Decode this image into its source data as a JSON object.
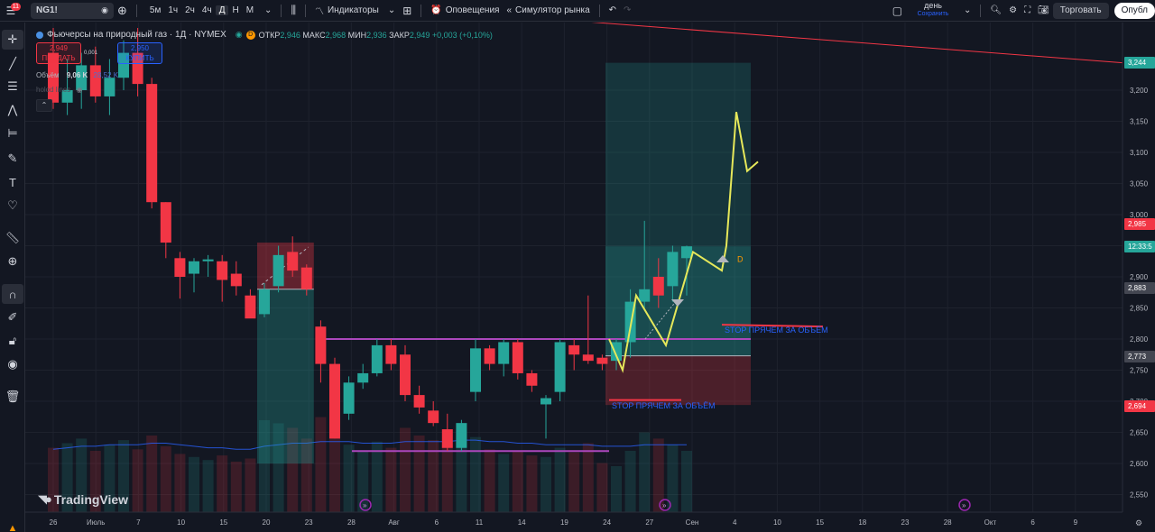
{
  "topbar": {
    "notification_count": "11",
    "symbol": "NG1!",
    "timeframes": [
      "5м",
      "1ч",
      "2ч",
      "4ч",
      "Д",
      "Н",
      "М"
    ],
    "active_timeframe": "Д",
    "indicators_label": "Индикаторы",
    "alerts_label": "Оповещения",
    "replay_label": "Симулятор рынка",
    "layout_name": "день",
    "layout_save": "Сохранить",
    "trade_label": "Торговать",
    "publish_label": "Опубл"
  },
  "legend": {
    "title": "Фьючерсы на природный газ · 1Д · NYMEX",
    "d_badge": "D",
    "open_label": "ОТКР",
    "open": "2,946",
    "high_label": "МАКС",
    "high": "2,968",
    "low_label": "МИН",
    "low": "2,936",
    "close_label": "ЗАКР",
    "close": "2,949",
    "change": "+0,003 (+0,10%)",
    "sell_price": "2,949",
    "sell_label": "ПРОДАТЬ",
    "spread": "0,001",
    "buy_price": "2,950",
    "buy_label": "КУПИТЬ",
    "volume_label": "Объём",
    "volume": "9,06 K",
    "volume_ma": "28,52 K",
    "hold_label": "holod lines"
  },
  "price_axis": {
    "ticks": [
      "3,200",
      "3,150",
      "3,100",
      "3,050",
      "3,000",
      "2,950",
      "2,900",
      "2,850",
      "2,800",
      "2,750",
      "2,700",
      "2,650",
      "2,600",
      "2,550"
    ],
    "badges": [
      {
        "text": "3,244",
        "color": "#26a69a"
      },
      {
        "text": "2,985",
        "color": "#f23645"
      },
      {
        "text": "12:33:5",
        "color": "#26a69a"
      },
      {
        "text": "2,883",
        "color": "#434651"
      },
      {
        "text": "2,773",
        "color": "#434651"
      },
      {
        "text": "2,694",
        "color": "#f23645"
      }
    ]
  },
  "time_axis": {
    "labels": [
      "26",
      "Июль",
      "7",
      "10",
      "15",
      "20",
      "23",
      "28",
      "Авг",
      "6",
      "11",
      "14",
      "19",
      "24",
      "27",
      "Сен",
      "4",
      "10",
      "15",
      "18",
      "23",
      "28",
      "Окт",
      "6",
      "9"
    ]
  },
  "annotations": {
    "stop_label_1": "STOP ПРЯЧЕМ ЗА ОБЪЁМ",
    "stop_label_2": "STOP ПРЯЧЕМ ЗА ОБЪЁМ",
    "d_marker": "D"
  },
  "branding": {
    "logo_text": "TradingView"
  },
  "chart_data": {
    "type": "candlestick",
    "title": "Фьючерсы на природный газ · 1Д · NYMEX",
    "ylim": [
      2.525,
      3.29
    ],
    "candles": [
      {
        "o": 3.26,
        "h": 3.3,
        "l": 3.17,
        "c": 3.18
      },
      {
        "o": 3.18,
        "h": 3.25,
        "l": 3.16,
        "c": 3.2
      },
      {
        "o": 3.2,
        "h": 3.26,
        "l": 3.17,
        "c": 3.24
      },
      {
        "o": 3.24,
        "h": 3.27,
        "l": 3.18,
        "c": 3.19
      },
      {
        "o": 3.19,
        "h": 3.25,
        "l": 3.16,
        "c": 3.22
      },
      {
        "o": 3.22,
        "h": 3.28,
        "l": 3.2,
        "c": 3.26
      },
      {
        "o": 3.26,
        "h": 3.3,
        "l": 3.19,
        "c": 3.21
      },
      {
        "o": 3.21,
        "h": 3.22,
        "l": 3.01,
        "c": 3.02
      },
      {
        "o": 3.02,
        "h": 3.02,
        "l": 2.93,
        "c": 2.955
      },
      {
        "o": 2.93,
        "h": 2.94,
        "l": 2.865,
        "c": 2.9
      },
      {
        "o": 2.905,
        "h": 2.93,
        "l": 2.875,
        "c": 2.925
      },
      {
        "o": 2.925,
        "h": 2.935,
        "l": 2.9,
        "c": 2.928
      },
      {
        "o": 2.925,
        "h": 2.935,
        "l": 2.86,
        "c": 2.895
      },
      {
        "o": 2.905,
        "h": 2.925,
        "l": 2.87,
        "c": 2.885
      },
      {
        "o": 2.87,
        "h": 2.88,
        "l": 2.84,
        "c": 2.833
      },
      {
        "o": 2.84,
        "h": 2.89,
        "l": 2.835,
        "c": 2.88
      },
      {
        "o": 2.885,
        "h": 2.95,
        "l": 2.875,
        "c": 2.935
      },
      {
        "o": 2.94,
        "h": 2.965,
        "l": 2.9,
        "c": 2.91
      },
      {
        "o": 2.915,
        "h": 2.92,
        "l": 2.87,
        "c": 2.88
      },
      {
        "o": 2.82,
        "h": 2.83,
        "l": 2.73,
        "c": 2.76
      },
      {
        "o": 2.76,
        "h": 2.77,
        "l": 2.64,
        "c": 2.64
      },
      {
        "o": 2.68,
        "h": 2.74,
        "l": 2.67,
        "c": 2.73
      },
      {
        "o": 2.73,
        "h": 2.76,
        "l": 2.72,
        "c": 2.745
      },
      {
        "o": 2.745,
        "h": 2.8,
        "l": 2.74,
        "c": 2.79
      },
      {
        "o": 2.79,
        "h": 2.8,
        "l": 2.75,
        "c": 2.76
      },
      {
        "o": 2.775,
        "h": 2.79,
        "l": 2.7,
        "c": 2.71
      },
      {
        "o": 2.71,
        "h": 2.725,
        "l": 2.68,
        "c": 2.69
      },
      {
        "o": 2.685,
        "h": 2.7,
        "l": 2.66,
        "c": 2.665
      },
      {
        "o": 2.655,
        "h": 2.68,
        "l": 2.62,
        "c": 2.625
      },
      {
        "o": 2.625,
        "h": 2.67,
        "l": 2.62,
        "c": 2.665
      },
      {
        "o": 2.715,
        "h": 2.8,
        "l": 2.7,
        "c": 2.785
      },
      {
        "o": 2.785,
        "h": 2.79,
        "l": 2.75,
        "c": 2.76
      },
      {
        "o": 2.76,
        "h": 2.8,
        "l": 2.74,
        "c": 2.795
      },
      {
        "o": 2.795,
        "h": 2.8,
        "l": 2.735,
        "c": 2.745
      },
      {
        "o": 2.745,
        "h": 2.75,
        "l": 2.715,
        "c": 2.725
      },
      {
        "o": 2.695,
        "h": 2.71,
        "l": 2.64,
        "c": 2.705
      },
      {
        "o": 2.715,
        "h": 2.8,
        "l": 2.7,
        "c": 2.795
      },
      {
        "o": 2.79,
        "h": 2.8,
        "l": 2.75,
        "c": 2.775
      },
      {
        "o": 2.775,
        "h": 2.87,
        "l": 2.76,
        "c": 2.765
      },
      {
        "o": 2.77,
        "h": 2.775,
        "l": 2.75,
        "c": 2.76
      },
      {
        "o": 2.765,
        "h": 2.8,
        "l": 2.75,
        "c": 2.795
      },
      {
        "o": 2.795,
        "h": 2.88,
        "l": 2.77,
        "c": 2.86
      },
      {
        "o": 2.86,
        "h": 2.99,
        "l": 2.85,
        "c": 2.88
      },
      {
        "o": 2.9,
        "h": 2.93,
        "l": 2.85,
        "c": 2.87
      },
      {
        "o": 2.885,
        "h": 2.95,
        "l": 2.86,
        "c": 2.94
      },
      {
        "o": 2.93,
        "h": 2.95,
        "l": 2.87,
        "c": 2.949
      }
    ],
    "volume": [
      0.42,
      0.45,
      0.48,
      0.4,
      0.44,
      0.47,
      0.41,
      0.5,
      0.43,
      0.38,
      0.36,
      0.34,
      0.37,
      0.33,
      0.35,
      0.6,
      0.58,
      0.55,
      0.48,
      0.62,
      0.52,
      0.44,
      0.4,
      0.46,
      0.42,
      0.55,
      0.5,
      0.47,
      0.44,
      0.53,
      0.49,
      0.41,
      0.38,
      0.4,
      0.37,
      0.36,
      0.42,
      0.39,
      0.45,
      0.32,
      0.3,
      0.4,
      0.52,
      0.48,
      0.44,
      0.4
    ],
    "volume_ma": [
      0.41,
      0.42,
      0.43,
      0.43,
      0.44,
      0.44,
      0.44,
      0.45,
      0.45,
      0.44,
      0.43,
      0.42,
      0.42,
      0.41,
      0.41,
      0.43,
      0.44,
      0.45,
      0.45,
      0.46,
      0.46,
      0.46,
      0.45,
      0.45,
      0.45,
      0.46,
      0.46,
      0.46,
      0.46,
      0.47,
      0.47,
      0.46,
      0.46,
      0.45,
      0.45,
      0.44,
      0.44,
      0.44,
      0.44,
      0.43,
      0.43,
      0.43,
      0.44,
      0.44,
      0.44,
      0.44
    ],
    "trend_line_start": 3.31,
    "trend_line_end": 3.244,
    "levels": [
      {
        "price": 2.8,
        "color": "#ab47bc"
      },
      {
        "price": 2.62,
        "color": "#ab47bc"
      },
      {
        "price": 2.702,
        "color": "#f23645"
      },
      {
        "price": 2.823,
        "color": "#f23645"
      }
    ],
    "position_early": {
      "entry": 2.88,
      "target": 2.955,
      "stop": 2.6
    },
    "position_long": {
      "entry": 2.773,
      "target": 3.244,
      "stop": 2.694,
      "inner_target": 2.949
    },
    "forecast_path": [
      2.8,
      2.75,
      2.87,
      2.79,
      2.94,
      2.91,
      2.95,
      3.165,
      3.07,
      3.085
    ],
    "marker_price": 2.93
  }
}
